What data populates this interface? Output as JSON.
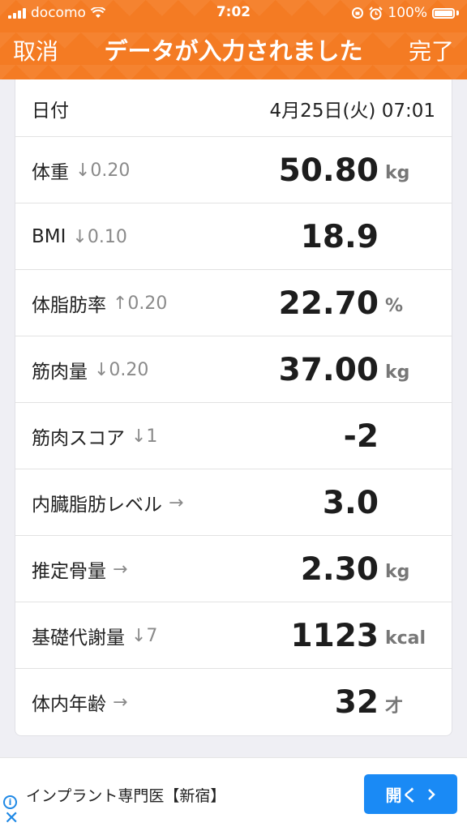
{
  "status_bar": {
    "carrier": "docomo",
    "time": "7:02",
    "battery": "100%"
  },
  "nav": {
    "cancel": "取消",
    "title": "データが入力されました",
    "done": "完了"
  },
  "date": {
    "label": "日付",
    "value": "4月25日(火) 07:01"
  },
  "rows": [
    {
      "label": "体重",
      "change": "↓0.20",
      "value": "50.80",
      "unit": "kg"
    },
    {
      "label": "BMI",
      "change": "↓0.10",
      "value": "18.9",
      "unit": ""
    },
    {
      "label": "体脂肪率",
      "change": "↑0.20",
      "value": "22.70",
      "unit": "%"
    },
    {
      "label": "筋肉量",
      "change": "↓0.20",
      "value": "37.00",
      "unit": "kg"
    },
    {
      "label": "筋肉スコア",
      "change": "↓1",
      "value": "-2",
      "unit": ""
    },
    {
      "label": "内臓脂肪レベル",
      "change": "→",
      "value": "3.0",
      "unit": ""
    },
    {
      "label": "推定骨量",
      "change": "→",
      "value": "2.30",
      "unit": "kg"
    },
    {
      "label": "基礎代謝量",
      "change": "↓7",
      "value": "1123",
      "unit": "kcal"
    },
    {
      "label": "体内年齢",
      "change": "→",
      "value": "32",
      "unit": "才"
    }
  ],
  "ad": {
    "text": "インプラント専門医【新宿】",
    "button": "開く",
    "info_icon": "i",
    "close_icon": "✕"
  },
  "colors": {
    "header": "#f47b23",
    "ad_button": "#1a8af5"
  }
}
